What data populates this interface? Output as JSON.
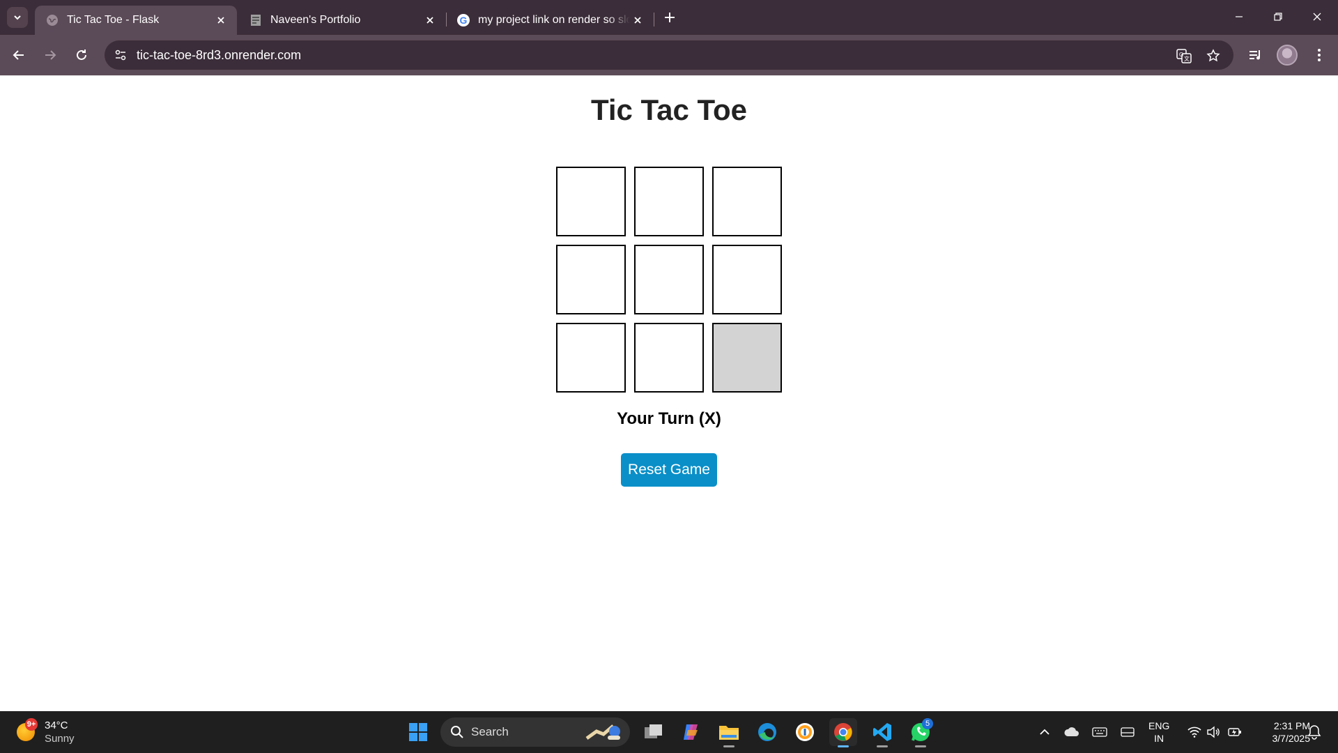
{
  "browser": {
    "tabs": [
      {
        "title": "Tic Tac Toe - Flask",
        "favicon": "globe-icon",
        "active": true
      },
      {
        "title": "Naveen's Portfolio",
        "favicon": "page-thumbnail-icon",
        "active": false
      },
      {
        "title": "my project link on render so slo",
        "favicon": "google-icon",
        "active": false
      }
    ],
    "url": "tic-tac-toe-8rd3.onrender.com"
  },
  "game": {
    "title": "Tic Tac Toe",
    "board": [
      "",
      "",
      "",
      "",
      "",
      "",
      "",
      "",
      ""
    ],
    "hovered_cell": 8,
    "status": "Your Turn (X)",
    "reset_label": "Reset Game"
  },
  "colors": {
    "tab_bar": "#3b2d39",
    "toolbar": "#5b4a57",
    "reset_button": "#0a8fc8",
    "hover_cell": "#d3d3d3"
  },
  "taskbar": {
    "weather": {
      "temp": "34°C",
      "condition": "Sunny",
      "badge": "9+"
    },
    "search_placeholder": "Search",
    "whatsapp_badge": "5",
    "language": {
      "line1": "ENG",
      "line2": "IN"
    },
    "clock": {
      "time": "2:31 PM",
      "date": "3/7/2025"
    }
  }
}
